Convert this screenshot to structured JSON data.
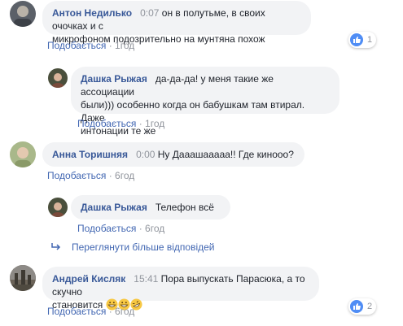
{
  "comments": [
    {
      "author": "Антон Недилько",
      "time": "0:07",
      "text_line1": "он в полутьме, в своих очочках и с",
      "text_line2": "микрофоном подозрительно на мунтяна похож",
      "like_label": "Подобається",
      "age": "1год",
      "reactions": "1",
      "avatar_color": "#5b6068",
      "replies": [
        {
          "author": "Дашка Рыжая",
          "text_line1": "да-да-да! у меня такие же ассоциации",
          "text_line2": "были))) особенно когда он бабушкам там втирал. Даже",
          "text_line3": "интонации те же",
          "like_label": "Подобається",
          "age": "1год",
          "avatar_color": "#4a4f3c"
        }
      ]
    },
    {
      "author": "Анна Торишняя",
      "time": "0:00",
      "text_line1": "Ну Дааашааааа!! Где кинооо?",
      "like_label": "Подобається",
      "age": "6год",
      "avatar_color": "#a9b88a",
      "replies": [
        {
          "author": "Дашка Рыжая",
          "text_line1": "Телефон всё",
          "like_label": "Подобається",
          "age": "6год",
          "avatar_color": "#4a4f3c"
        }
      ]
    },
    {
      "author": "Андрей Кисляк",
      "time": "15:41",
      "text_line1": "Пора выпускать Парасюка, а то скучно",
      "text_line2": "становится",
      "like_label": "Подобається",
      "age": "6год",
      "reactions": "2",
      "avatar_color": "#6b6358"
    }
  ],
  "more_replies": "Переглянути більше відповідей",
  "dot": "·",
  "colors": {
    "name": "#385898",
    "link": "#4267b2",
    "muted": "#90949c",
    "bubble": "#f2f3f5",
    "like_blue": "#4f8df5"
  }
}
